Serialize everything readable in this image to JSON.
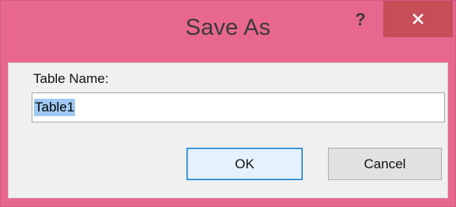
{
  "dialog": {
    "title": "Save As",
    "help_glyph": "?",
    "close_icon": "close-icon",
    "frame_color": "#e8678f",
    "close_color": "#c74d58"
  },
  "form": {
    "label": "Table Name:",
    "value": "Table1"
  },
  "buttons": {
    "ok_label": "OK",
    "cancel_label": "Cancel"
  }
}
